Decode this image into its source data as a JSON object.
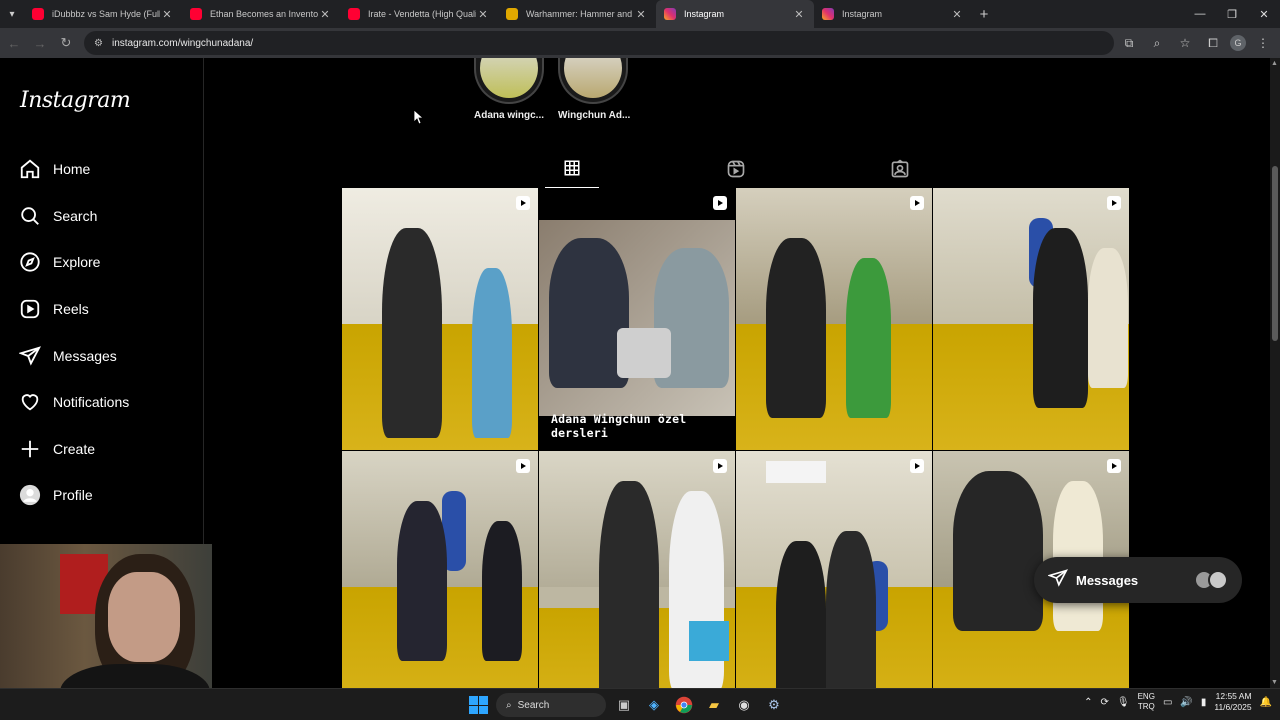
{
  "browser": {
    "tabs": [
      {
        "title": "iDubbbz vs Sam Hyde (Full Unc",
        "favicon_color": "#ff0033"
      },
      {
        "title": "Ethan Becomes an Inventor -- h",
        "favicon_color": "#ff0033"
      },
      {
        "title": "Irate - Vendetta (High Quality)",
        "favicon_color": "#ff0033"
      },
      {
        "title": "Warhammer: Hammer and Bolte",
        "favicon_color": "#e0a800"
      },
      {
        "title": "Instagram",
        "favicon_color": "#e1306c"
      },
      {
        "title": "Instagram",
        "favicon_color": "#e1306c"
      }
    ],
    "url": "instagram.com/wingchunadana/",
    "profile_initial": "G"
  },
  "instagram": {
    "logo": "Instagram",
    "nav": [
      {
        "label": "Home",
        "icon": "home-icon"
      },
      {
        "label": "Search",
        "icon": "search-icon"
      },
      {
        "label": "Explore",
        "icon": "compass-icon"
      },
      {
        "label": "Reels",
        "icon": "reels-icon"
      },
      {
        "label": "Messages",
        "icon": "messenger-icon"
      },
      {
        "label": "Notifications",
        "icon": "heart-icon"
      },
      {
        "label": "Create",
        "icon": "plus-icon"
      },
      {
        "label": "Profile",
        "icon": "avatar-icon"
      }
    ],
    "highlights": [
      {
        "label": "Adana wingc..."
      },
      {
        "label": "Wingchun Ad..."
      }
    ],
    "profile_tabs": [
      {
        "name": "posts",
        "icon": "grid-icon",
        "active": true
      },
      {
        "name": "reels",
        "icon": "reels-icon",
        "active": false
      },
      {
        "name": "tagged",
        "icon": "tagged-icon",
        "active": false
      }
    ],
    "posts_caption": "Adana Wingchun özel dersleri",
    "messages_pill": "Messages"
  },
  "taskbar": {
    "search": "Search",
    "lang_top": "ENG",
    "lang_bottom": "TRQ",
    "time": "12:55 AM",
    "date": "11/6/2025"
  },
  "colors": {
    "accent_floor": "#c9a400",
    "background": "#000000",
    "pill": "#262626"
  }
}
